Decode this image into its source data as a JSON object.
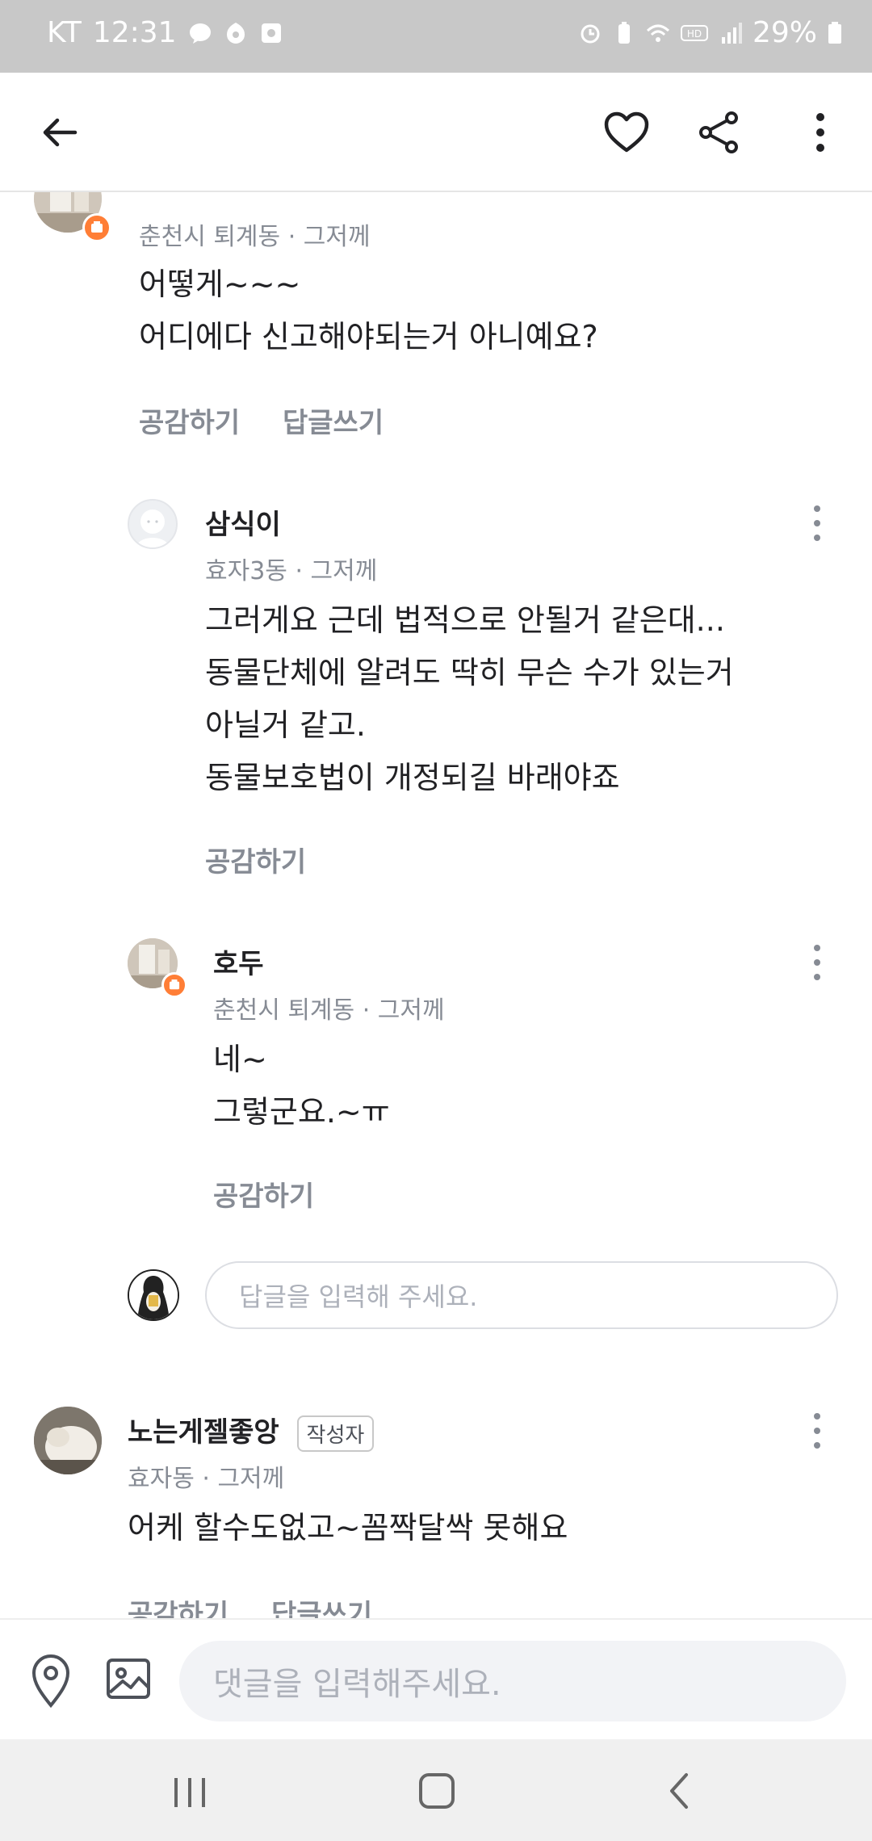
{
  "status_bar": {
    "carrier": "KT",
    "time": "12:31",
    "battery": "29%"
  },
  "comments": [
    {
      "location": "춘천시 퇴계동",
      "time": "그저께",
      "text_lines": [
        "어떻게~~~",
        "어디에다 신고해야되는거 아니예요?"
      ],
      "like_label": "공감하기",
      "reply_label": "답글쓰기"
    },
    {
      "name": "삼식이",
      "location": "효자3동",
      "time": "그저께",
      "text_lines": [
        "그러게요 근데 법적으로 안될거 같은대...",
        "동물단체에 알려도 딱히 무슨 수가 있는거",
        "아닐거 같고.",
        "동물보호법이 개정되길 바래야죠"
      ],
      "like_label": "공감하기"
    },
    {
      "name": "호두",
      "location": "춘천시 퇴계동",
      "time": "그저께",
      "text_lines": [
        "네~",
        "그렇군요.~ㅠ"
      ],
      "like_label": "공감하기"
    },
    {
      "name": "노는게젤좋앙",
      "author_tag": "작성자",
      "location": "효자동",
      "time": "그저께",
      "text_lines": [
        "어케 할수도없고~꼼짝달싹 못해요"
      ],
      "like_label": "공감하기",
      "reply_label": "답글쓰기"
    }
  ],
  "reply_input": {
    "placeholder": "답글을 입력해 주세요."
  },
  "comment_input": {
    "placeholder": "댓글을 입력해주세요."
  },
  "separator": "·",
  "colors": {
    "accent": "#ff7e36",
    "gray_text": "#868b94"
  }
}
